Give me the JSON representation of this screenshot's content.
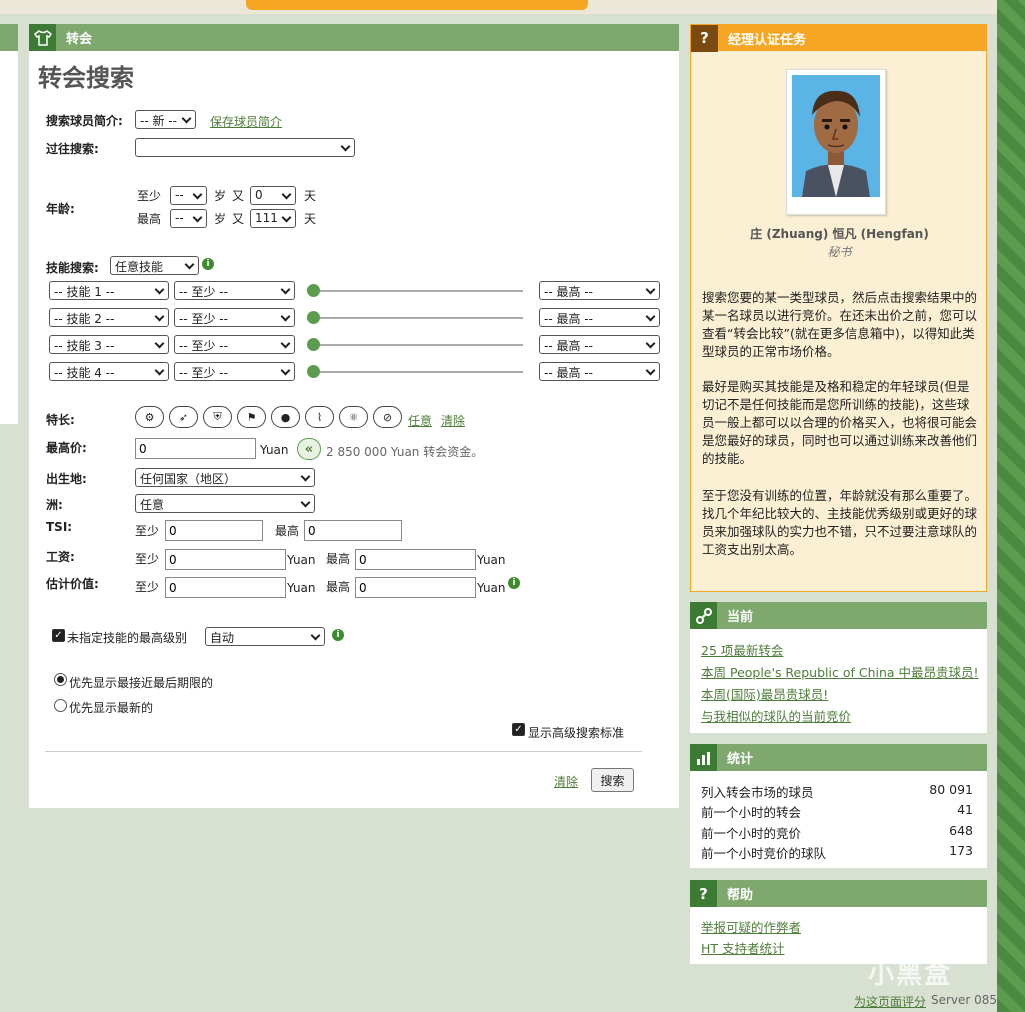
{
  "main": {
    "header_title": "转会",
    "page_title": "转会搜索",
    "profile_label": "搜索球员简介:",
    "profile_select": "-- 新 --",
    "save_profile": "保存球员简介",
    "past_search_label": "过往搜索:",
    "past_search_select": "",
    "age_label": "年龄:",
    "age_min_label": "至少",
    "age_max_label": "最高",
    "years_unit": "岁",
    "and_label": "又",
    "days_unit": "天",
    "age_min_years": "--",
    "age_min_days": "0",
    "age_max_years": "--",
    "age_max_days": "111",
    "skill_search_label": "技能搜索:",
    "skill_search_select": "任意技能",
    "skill_rows": [
      {
        "skill": "-- 技能 1 --",
        "min": "-- 至少 --",
        "max": "-- 最高 --"
      },
      {
        "skill": "-- 技能 2 --",
        "min": "-- 至少 --",
        "max": "-- 最高 --"
      },
      {
        "skill": "-- 技能 3 --",
        "min": "-- 至少 --",
        "max": "-- 最高 --"
      },
      {
        "skill": "-- 技能 4 --",
        "min": "-- 至少 --",
        "max": "-- 最高 --"
      }
    ],
    "specialty_label": "特长:",
    "specialty_any": "任意",
    "specialty_clear": "清除",
    "max_price_label": "最高价:",
    "max_price_value": "0",
    "currency": "Yuan",
    "funds_text": "2 850 000 Yuan 转会资金。",
    "birthplace_label": "出生地:",
    "birthplace_select": "任何国家（地区）",
    "continent_label": "洲:",
    "continent_select": "任意",
    "tsi_label": "TSI:",
    "tsi_min_label": "至少",
    "tsi_min": "0",
    "tsi_max_label": "最高",
    "tsi_max": "0",
    "wage_label": "工资:",
    "wage_min_label": "至少",
    "wage_min": "0",
    "wage_max_label": "最高",
    "wage_max": "0",
    "estimate_label": "估计价值:",
    "estimate_min_label": "至少",
    "estimate_min": "0",
    "estimate_max_label": "最高",
    "estimate_max": "0",
    "max_level_label": "未指定技能的最高级别",
    "max_level_select": "自动",
    "radio_deadline": "优先显示最接近最后期限的",
    "radio_newest": "优先显示最新的",
    "advanced_label": "显示高级搜索标准",
    "clear_link": "清除",
    "search_button": "搜索"
  },
  "manager": {
    "header_title": "经理认证任务",
    "name": "庄 (Zhuang) 恒凡 (Hengfan)",
    "role": "秘书",
    "para1": "搜索您要的某一类型球员，然后点击搜索结果中的某一名球员以进行竞价。在还未出价之前，您可以查看“转会比较”(就在更多信息箱中)，以得知此类型球员的正常市场价格。",
    "para2": "最好是购买其技能是及格和稳定的年轻球员(但是切记不是任何技能而是您所训练的技能)，这些球员一般上都可以以合理的价格买入，也将很可能会是您最好的球员，同时也可以通过训练来改善他们的技能。",
    "para3": "至于您没有训练的位置，年龄就没有那么重要了。找几个年纪比较大的、主技能优秀级别或更好的球员来加强球队的实力也不错，只不过要注意球队的工资支出别太高。"
  },
  "current": {
    "header_title": "当前",
    "links": [
      "25 项最新转会",
      "本周 People's Republic of China 中最昂贵球员!",
      "本周(国际)最昂贵球员!",
      "与我相似的球队的当前竞价"
    ]
  },
  "stats": {
    "header_title": "统计",
    "rows": [
      {
        "label": "列入转会市场的球员",
        "value": "80 091"
      },
      {
        "label": "前一个小时的转会",
        "value": "41"
      },
      {
        "label": "前一个小时的竞价",
        "value": "648"
      },
      {
        "label": "前一个小时竞价的球队",
        "value": "173"
      }
    ]
  },
  "help": {
    "header_title": "帮助",
    "links": [
      "举报可疑的作弊者",
      "HT 支持者统计"
    ]
  },
  "footer": {
    "rate_link": "为这页面评分",
    "server": "Server 085",
    "watermark": "小黑盒"
  },
  "colors": {
    "header_green": "#7fa86f",
    "icon_green": "#3d7a33",
    "orange": "#f5a623",
    "link_green": "#4e7d3a"
  }
}
